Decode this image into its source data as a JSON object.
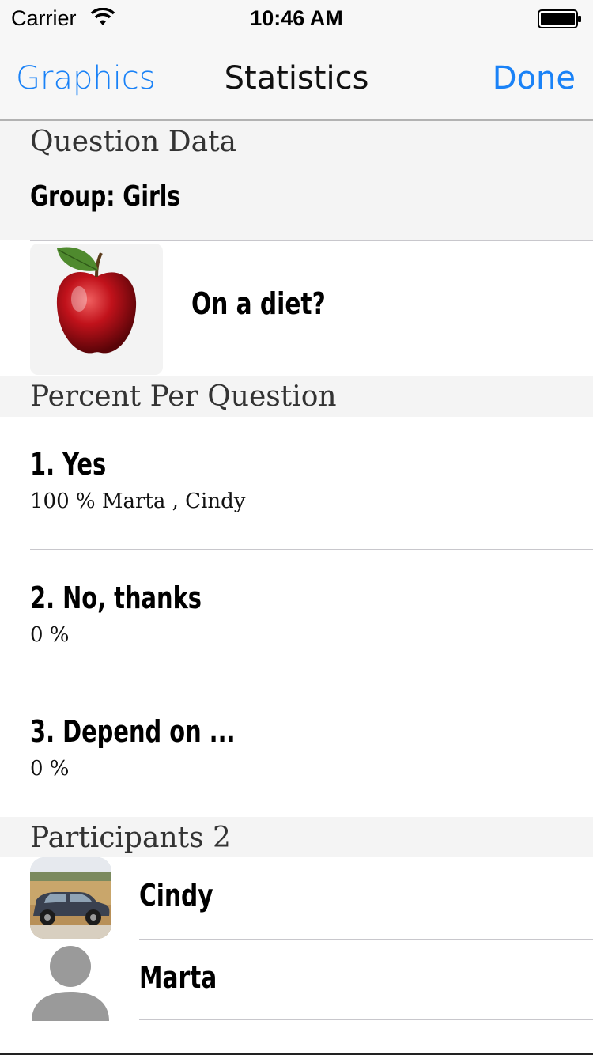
{
  "status_bar": {
    "carrier": "Carrier",
    "time": "10:46 AM",
    "icons": [
      "wifi-icon",
      "battery-icon"
    ]
  },
  "navbar": {
    "left": "Graphics",
    "title": "Statistics",
    "right": "Done",
    "accent": "#1a82f7"
  },
  "question_section": {
    "header": "Question Data",
    "group": "Group: Girls",
    "question": "On a diet?",
    "image": "apple-image"
  },
  "percent_section": {
    "header": "Percent Per Question",
    "answers": [
      {
        "title": "1. Yes",
        "detail": "100 % Marta , Cindy"
      },
      {
        "title": "2. No, thanks",
        "detail": "0 %"
      },
      {
        "title": "3. Depend on ...",
        "detail": "0 %"
      }
    ]
  },
  "participants_section": {
    "header": "Participants 2",
    "participants": [
      {
        "name": "Cindy",
        "avatar": "car-photo"
      },
      {
        "name": "Marta",
        "avatar": "default-person-icon"
      }
    ]
  }
}
